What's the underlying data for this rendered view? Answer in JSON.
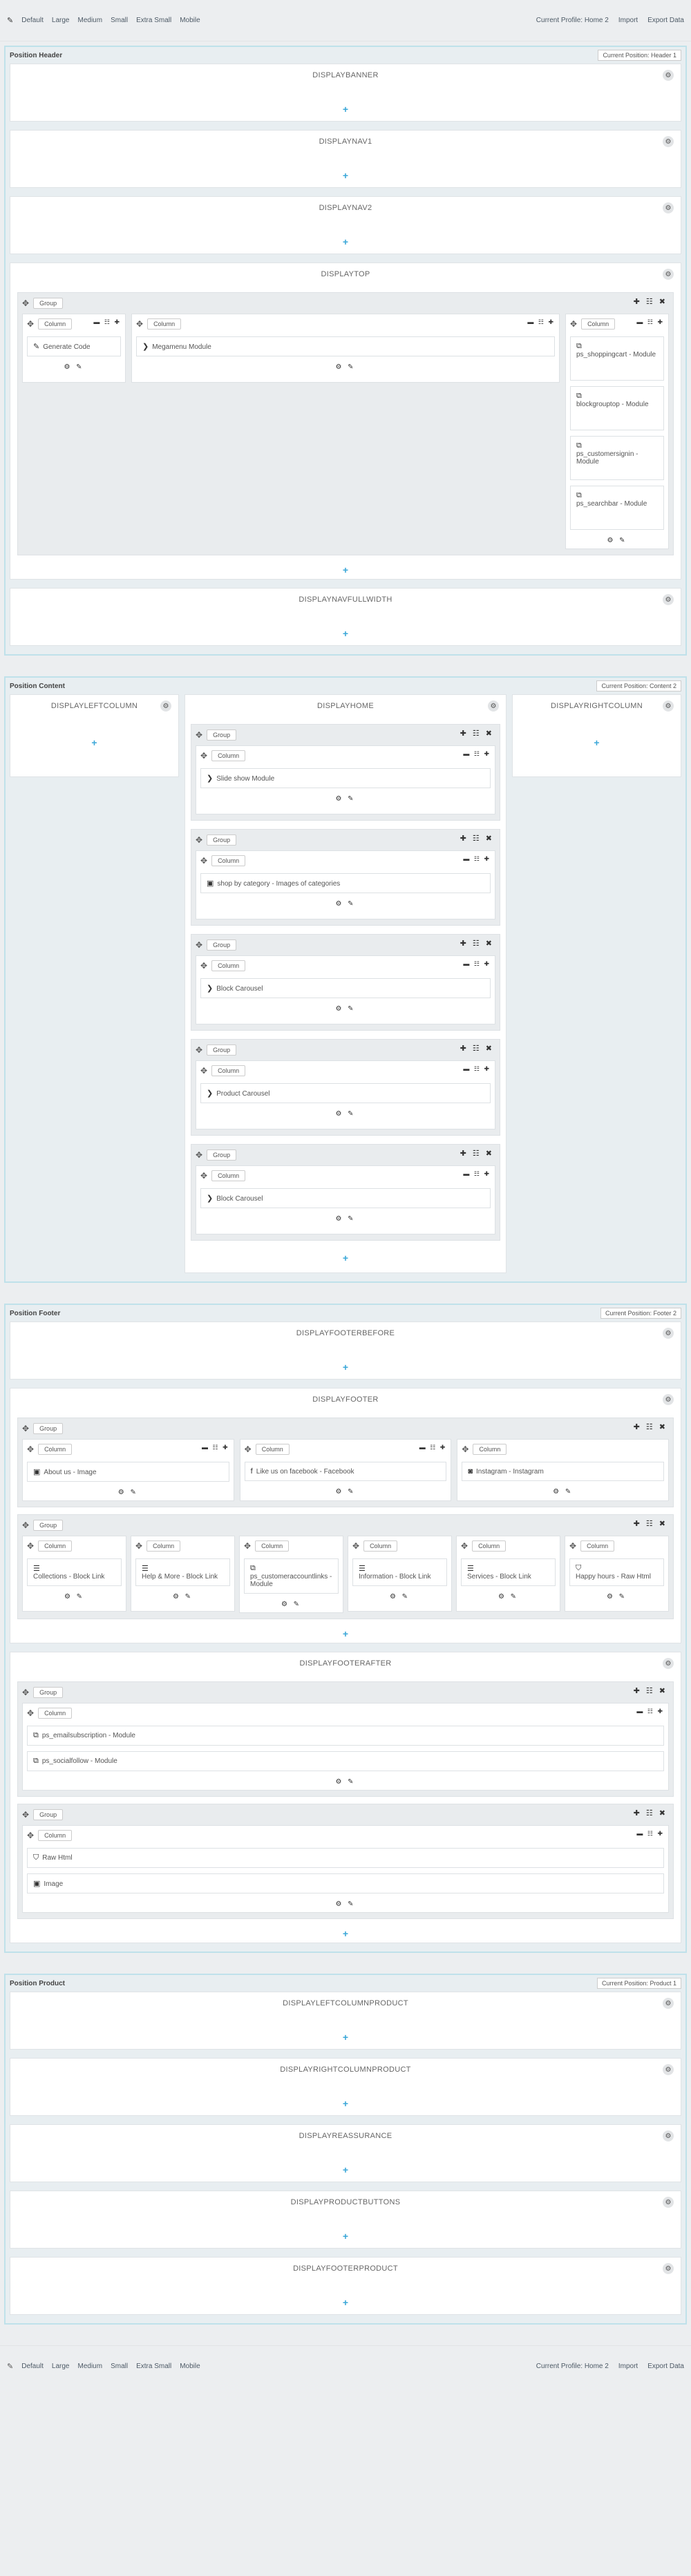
{
  "toolbar": {
    "items": [
      "Default",
      "Large",
      "Medium",
      "Small",
      "Extra Small",
      "Mobile"
    ],
    "profile": "Current Profile: Home 2",
    "import": "Import",
    "export": "Export Data"
  },
  "header": {
    "title": "Position Header",
    "profile": "Current Position: Header 1",
    "hooks": {
      "banner": "DISPLAYBANNER",
      "nav1": "DISPLAYNAV1",
      "nav2": "DISPLAYNAV2",
      "top": "DISPLAYTOP",
      "navfull": "DISPLAYNAVFULLWIDTH"
    },
    "top_modules": {
      "generate": "Generate Code",
      "megamenu": "Megamenu Module",
      "right": [
        "ps_shoppingcart - Module",
        "blockgrouptop - Module",
        "ps_customersignin - Module",
        "ps_searchbar - Module"
      ]
    }
  },
  "content": {
    "title": "Position Content",
    "profile": "Current Position: Content 2",
    "left": "DISPLAYLEFTCOLUMN",
    "home": "DISPLAYHOME",
    "right": "DISPLAYRIGHTCOLUMN",
    "modules": [
      "Slide show Module",
      "shop by category - Images of categories",
      "Block Carousel",
      "Product Carousel",
      "Block Carousel"
    ]
  },
  "footer": {
    "title": "Position Footer",
    "profile": "Current Position: Footer 2",
    "before": "DISPLAYFOOTERBEFORE",
    "footer": "DISPLAYFOOTER",
    "after": "DISPLAYFOOTERAFTER",
    "row1": [
      "About us - Image",
      "Like us on facebook - Facebook",
      "Instagram - Instagram"
    ],
    "row2": [
      "Collections - Block Link",
      "Help & More - Block Link",
      "ps_customeraccountlinks - Module",
      "Information - Block Link",
      "Services - Block Link",
      "Happy hours - Raw Html"
    ],
    "after_g1": [
      "ps_emailsubscription - Module",
      "ps_socialfollow - Module"
    ],
    "after_g2": [
      "Raw Html",
      "Image"
    ]
  },
  "product": {
    "title": "Position Product",
    "profile": "Current Position: Product 1",
    "hooks": [
      "DISPLAYLEFTCOLUMNPRODUCT",
      "DISPLAYRIGHTCOLUMNPRODUCT",
      "DISPLAYREASSURANCE",
      "DISPLAYPRODUCTBUTTONS",
      "DISPLAYFOOTERPRODUCT"
    ]
  },
  "labels": {
    "group": "Group",
    "column": "Column"
  }
}
